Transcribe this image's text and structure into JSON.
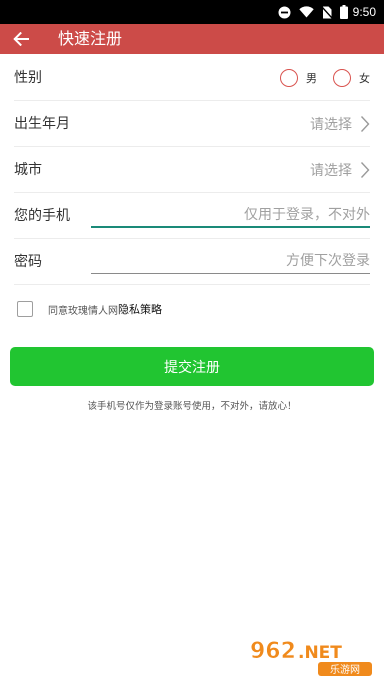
{
  "status_bar": {
    "time": "9:50"
  },
  "app_bar": {
    "title": "快速注册"
  },
  "form": {
    "gender": {
      "label": "性别",
      "options": [
        "男",
        "女"
      ]
    },
    "birth": {
      "label": "出生年月",
      "placeholder": "请选择"
    },
    "city": {
      "label": "城市",
      "placeholder": "请选择"
    },
    "phone": {
      "label": "您的手机",
      "placeholder": "仅用于登录，不对外"
    },
    "password": {
      "label": "密码",
      "placeholder": "方便下次登录"
    }
  },
  "agreement": {
    "text": "同意玫瑰情人网",
    "policy_link": "隐私策略"
  },
  "submit": {
    "label": "提交注册"
  },
  "note": "该手机号仅作为登录账号使用，不对外，请放心！",
  "colors": {
    "app_bar": "#cc4b48",
    "submit": "#21c531",
    "focus_underline": "#1a8a78"
  },
  "watermark": {
    "text": "962.NET",
    "subtext": "乐游网"
  }
}
